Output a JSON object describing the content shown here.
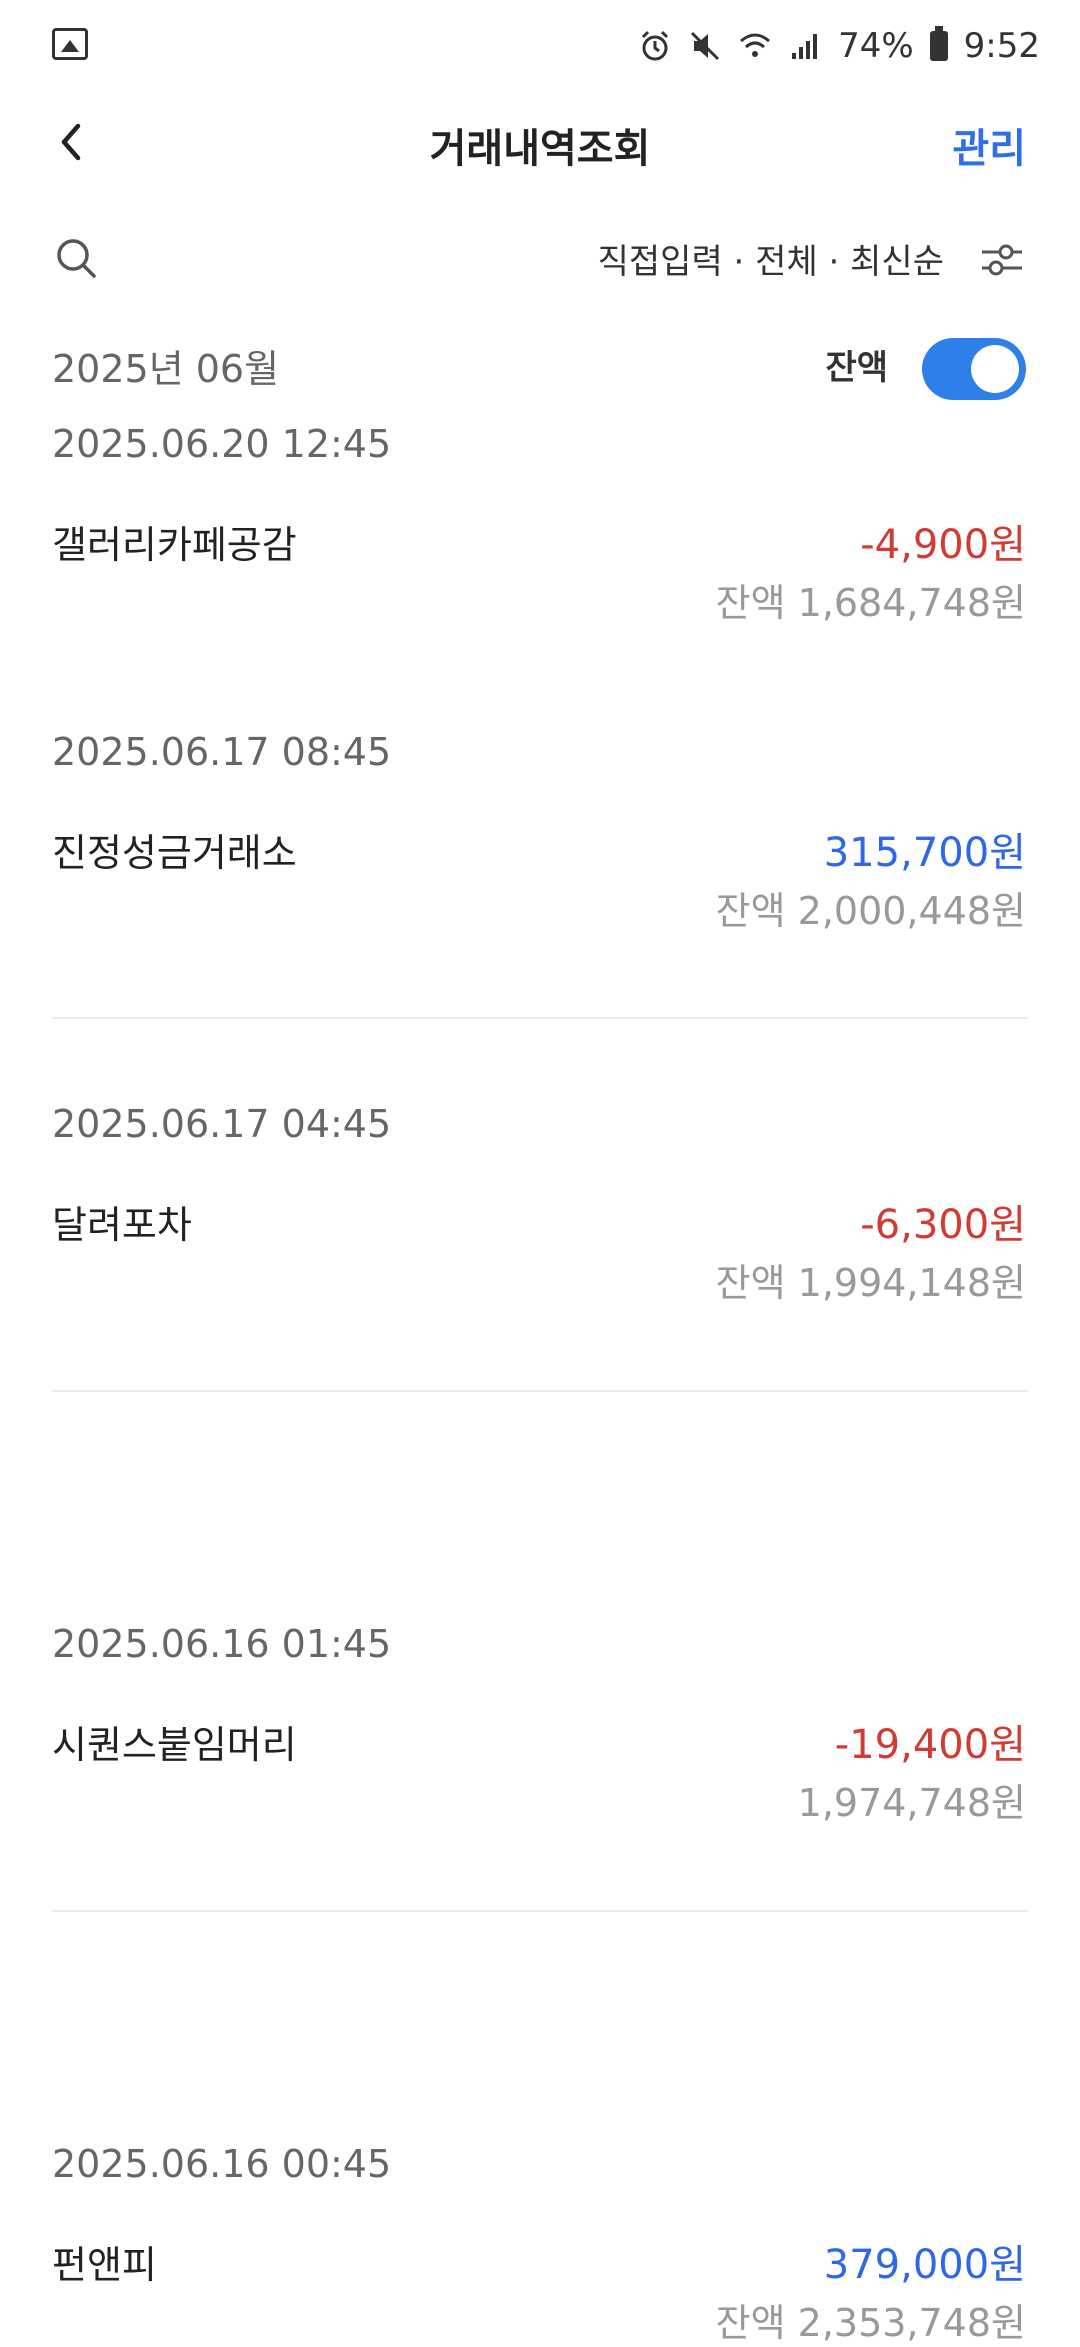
{
  "status_bar": {
    "battery_percent": "74%",
    "time": "9:52",
    "left_icon": "gallery-notification-icon",
    "icons": [
      "alarm-icon",
      "mute-icon",
      "wifi-icon",
      "signal-icon",
      "battery-icon"
    ]
  },
  "header": {
    "title": "거래내역조회",
    "manage_label": "관리",
    "back_icon": "chevron-left-icon"
  },
  "filter": {
    "summary": "직접입력 · 전체 · 최신순",
    "search_icon": "search-icon",
    "filter_icon": "filter-settings-icon"
  },
  "month": {
    "label": "2025년 06월",
    "balance_toggle_label": "잔액",
    "balance_toggle_on": true
  },
  "transactions": [
    {
      "date": "2025.06.20 12:45",
      "merchant": "갤러리카페공감",
      "amount": "-4,900원",
      "type": "withdrawal",
      "balance": "잔액 1,684,748원"
    },
    {
      "date": "2025.06.17 08:45",
      "merchant": "진정성금거래소",
      "amount": "315,700원",
      "type": "deposit",
      "balance": "잔액 2,000,448원"
    },
    {
      "date": "2025.06.17 04:45",
      "merchant": "달려포차",
      "amount": "-6,300원",
      "type": "withdrawal",
      "balance": "잔액 1,994,148원"
    },
    {
      "date": "2025.06.16 01:45",
      "merchant": "시퀀스붙임머리",
      "amount": "-19,400원",
      "type": "withdrawal",
      "balance": "1,974,748원"
    },
    {
      "date": "2025.06.16 00:45",
      "merchant": "펀앤피",
      "amount": "379,000원",
      "type": "deposit",
      "balance": "잔액 2,353,748원"
    }
  ],
  "colors": {
    "accent": "#2f6fe8",
    "withdrawal": "#d23a34",
    "deposit": "#2f67e8",
    "toggle_on": "#2f7fe8"
  }
}
